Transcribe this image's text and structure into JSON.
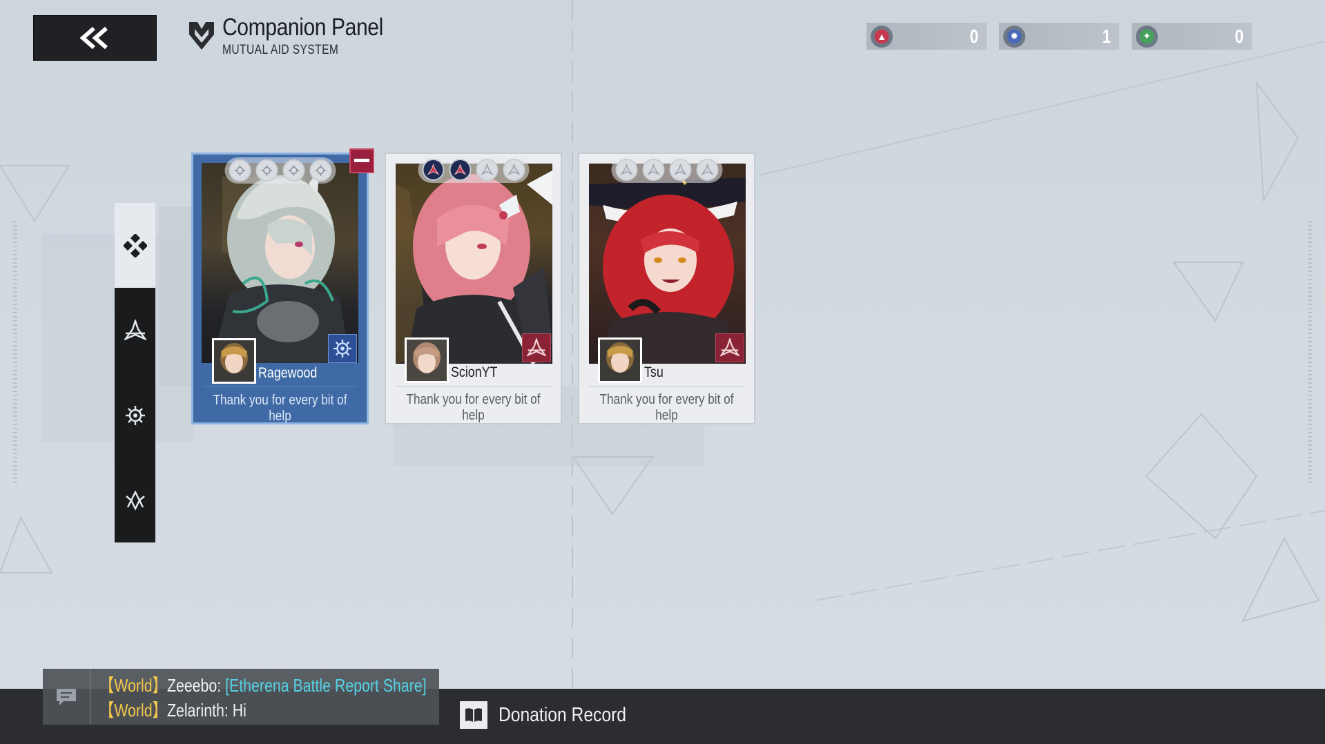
{
  "header": {
    "title": "Companion Panel",
    "subtitle": "MUTUAL AID SYSTEM"
  },
  "currencies": [
    {
      "icon": "red-assault-emblem-icon",
      "value": "0",
      "color": "#b8344a"
    },
    {
      "icon": "blue-crest-emblem-icon",
      "value": "1",
      "color": "#3e5ca8"
    },
    {
      "icon": "green-crest-emblem-icon",
      "value": "0",
      "color": "#3f8f4f"
    }
  ],
  "side_tabs": [
    {
      "name": "all-classes",
      "icon": "diamond-cluster-icon",
      "active": true
    },
    {
      "name": "assault",
      "icon": "assault-class-icon",
      "active": false
    },
    {
      "name": "support",
      "icon": "gear-sun-class-icon",
      "active": false
    },
    {
      "name": "vanguard",
      "icon": "wing-crest-class-icon",
      "active": false
    }
  ],
  "cards": [
    {
      "owner": "Ragewood",
      "message": "Thank you for every bit of help",
      "selected": true,
      "skills_filled": 0,
      "skill_type": "support",
      "class_icon": "gear-sun-class-icon",
      "accent": "#3e5ca8"
    },
    {
      "owner": "ScionYT",
      "message": "Thank you for every bit of help",
      "selected": false,
      "skills_filled": 2,
      "skill_type": "assault",
      "class_icon": "assault-class-icon",
      "accent": "#9a2a3c"
    },
    {
      "owner": "Tsu",
      "message": "Thank you for every bit of help",
      "selected": false,
      "skills_filled": 0,
      "skill_type": "assault",
      "class_icon": "assault-class-icon",
      "accent": "#9a2a3c"
    }
  ],
  "chat": {
    "lines": [
      {
        "channel": "【World】",
        "sender": "Zeeebo:",
        "text": "[Etherena Battle Report Share]",
        "is_link": true
      },
      {
        "channel": "【World】",
        "sender": "Zelarinth:",
        "text": "Hi",
        "is_link": false
      }
    ]
  },
  "footer": {
    "donation_label": "Donation Record"
  }
}
